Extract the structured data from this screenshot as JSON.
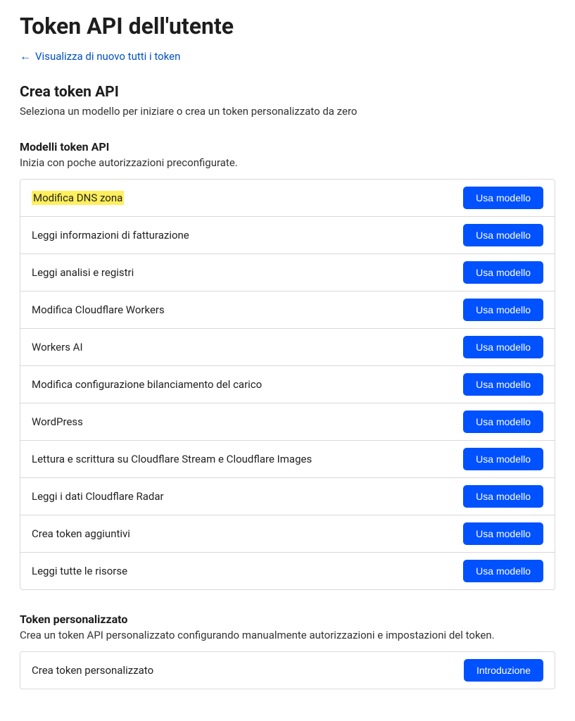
{
  "page": {
    "title": "Token API dell'utente",
    "back_link": "Visualizza di nuovo tutti i token"
  },
  "create": {
    "heading": "Crea token API",
    "subheading": "Seleziona un modello per iniziare o crea un token personalizzato da zero"
  },
  "templates": {
    "heading": "Modelli token API",
    "subheading": "Inizia con poche autorizzazioni preconfigurate.",
    "button_label": "Usa modello",
    "items": [
      {
        "label": "Modifica DNS zona",
        "highlight": true
      },
      {
        "label": "Leggi informazioni di fatturazione",
        "highlight": false
      },
      {
        "label": "Leggi analisi e registri",
        "highlight": false
      },
      {
        "label": "Modifica Cloudflare Workers",
        "highlight": false
      },
      {
        "label": "Workers AI",
        "highlight": false
      },
      {
        "label": "Modifica configurazione bilanciamento del carico",
        "highlight": false
      },
      {
        "label": "WordPress",
        "highlight": false
      },
      {
        "label": "Lettura e scrittura su Cloudflare Stream e Cloudflare Images",
        "highlight": false
      },
      {
        "label": "Leggi i dati Cloudflare Radar",
        "highlight": false
      },
      {
        "label": "Crea token aggiuntivi",
        "highlight": false
      },
      {
        "label": "Leggi tutte le risorse",
        "highlight": false
      }
    ]
  },
  "custom": {
    "heading": "Token personalizzato",
    "subheading": "Crea un token API personalizzato configurando manualmente autorizzazioni e impostazioni del token.",
    "row_label": "Crea token personalizzato",
    "button_label": "Introduzione"
  }
}
